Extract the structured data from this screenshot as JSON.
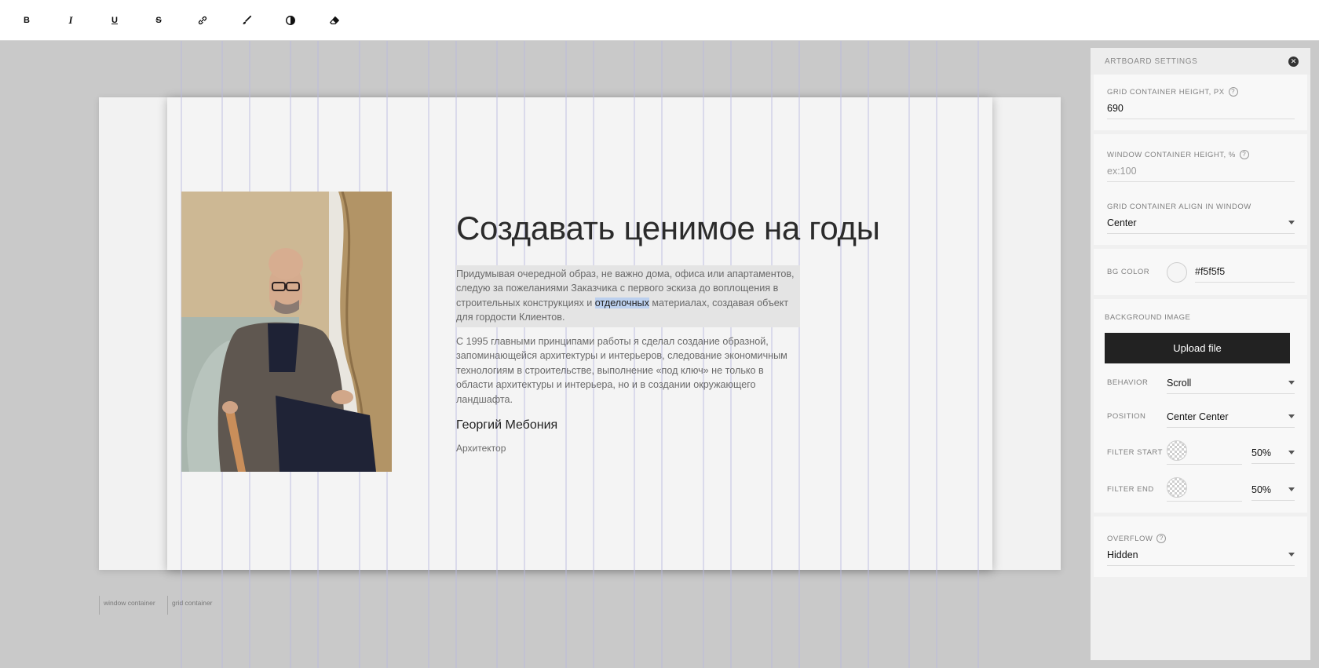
{
  "toolbar": {
    "items": [
      {
        "name": "bold",
        "glyph": "B"
      },
      {
        "name": "italic",
        "glyph": "I"
      },
      {
        "name": "underline",
        "glyph": "U"
      },
      {
        "name": "strikethrough",
        "glyph": "S"
      },
      {
        "name": "link",
        "glyph": ""
      },
      {
        "name": "brush",
        "glyph": ""
      },
      {
        "name": "contrast",
        "glyph": ""
      },
      {
        "name": "eraser",
        "glyph": ""
      }
    ]
  },
  "canvas": {
    "heading": "Создавать ценимое на годы",
    "para1_before": "Придумывая очередной образ, не важно дома, офиса или апартаментов, следую за пожеланиями Заказчика с первого эскиза до воплощения в строительных конструкциях и ",
    "para1_highlight": "отделочных",
    "para1_after": " материалах, создавая объект для гордости Клиентов.",
    "para2": "С 1995 главными принципами работы я сделал создание образной, запоминающейся архитектуры и интерьеров, следование экономичным технологиям в строительстве, выполнение «под ключ» не только в области архитектуры и интерьера, но и в создании окружающего ландшафта.",
    "author_name": "Георгий Мебония",
    "author_role": "Архитектор",
    "label_window": "window container",
    "label_grid": "grid container"
  },
  "panel": {
    "title": "ARTBOARD SETTINGS",
    "grid_height_label": "GRID CONTAINER HEIGHT, PX",
    "grid_height_value": "690",
    "window_height_label": "WINDOW CONTAINER HEIGHT, %",
    "window_height_placeholder": "ex:100",
    "align_label": "GRID CONTAINER ALIGN IN WINDOW",
    "align_value": "Center",
    "bg_color_label": "BG COLOR",
    "bg_color_value": "#f5f5f5",
    "bg_image_label": "BACKGROUND IMAGE",
    "upload_label": "Upload file",
    "behavior_label": "BEHAVIOR",
    "behavior_value": "Scroll",
    "position_label": "POSITION",
    "position_value": "Center Center",
    "filter_start_label": "FILTER START",
    "filter_start_value": "50%",
    "filter_end_label": "FILTER END",
    "filter_end_value": "50%",
    "overflow_label": "OVERFLOW",
    "overflow_value": "Hidden"
  },
  "colors": {
    "workspace": "#c9c9c9",
    "grid_bg": "#f4f4f4",
    "guide_line": "#b7b7dc",
    "button_dark": "#222222"
  }
}
